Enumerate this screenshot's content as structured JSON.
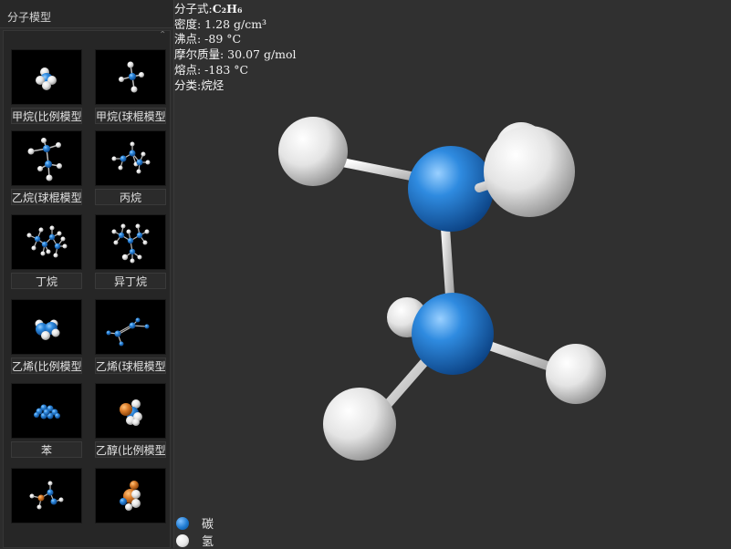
{
  "sidebar": {
    "title": "分子模型",
    "items": [
      {
        "label": "甲烷(比例模型)"
      },
      {
        "label": "甲烷(球棍模型)"
      },
      {
        "label": "乙烷(球棍模型)"
      },
      {
        "label": "丙烷"
      },
      {
        "label": "丁烷"
      },
      {
        "label": "异丁烷"
      },
      {
        "label": "乙烯(比例模型)"
      },
      {
        "label": "乙烯(球棍模型)"
      },
      {
        "label": "苯"
      },
      {
        "label": "乙醇(比例模型)"
      },
      {
        "label": ""
      },
      {
        "label": ""
      }
    ]
  },
  "info": {
    "formula_label": "分子式:",
    "formula": "C₂H₆",
    "density": "密度: 1.28 g/cm³",
    "boiling_point": "沸点: -89 °C",
    "molar_mass": "摩尔质量: 30.07 g/mol",
    "melting_point": "熔点: -183 °C",
    "category": "分类:烷烃"
  },
  "legend": [
    {
      "label": "碳",
      "color": "#1e7ad0"
    },
    {
      "label": "氢",
      "color": "#f2f2f2"
    }
  ],
  "colors": {
    "carbon": "#1e7ad0",
    "hydrogen": "#ededed",
    "oxygen": "#d07020",
    "background": "#303030"
  }
}
